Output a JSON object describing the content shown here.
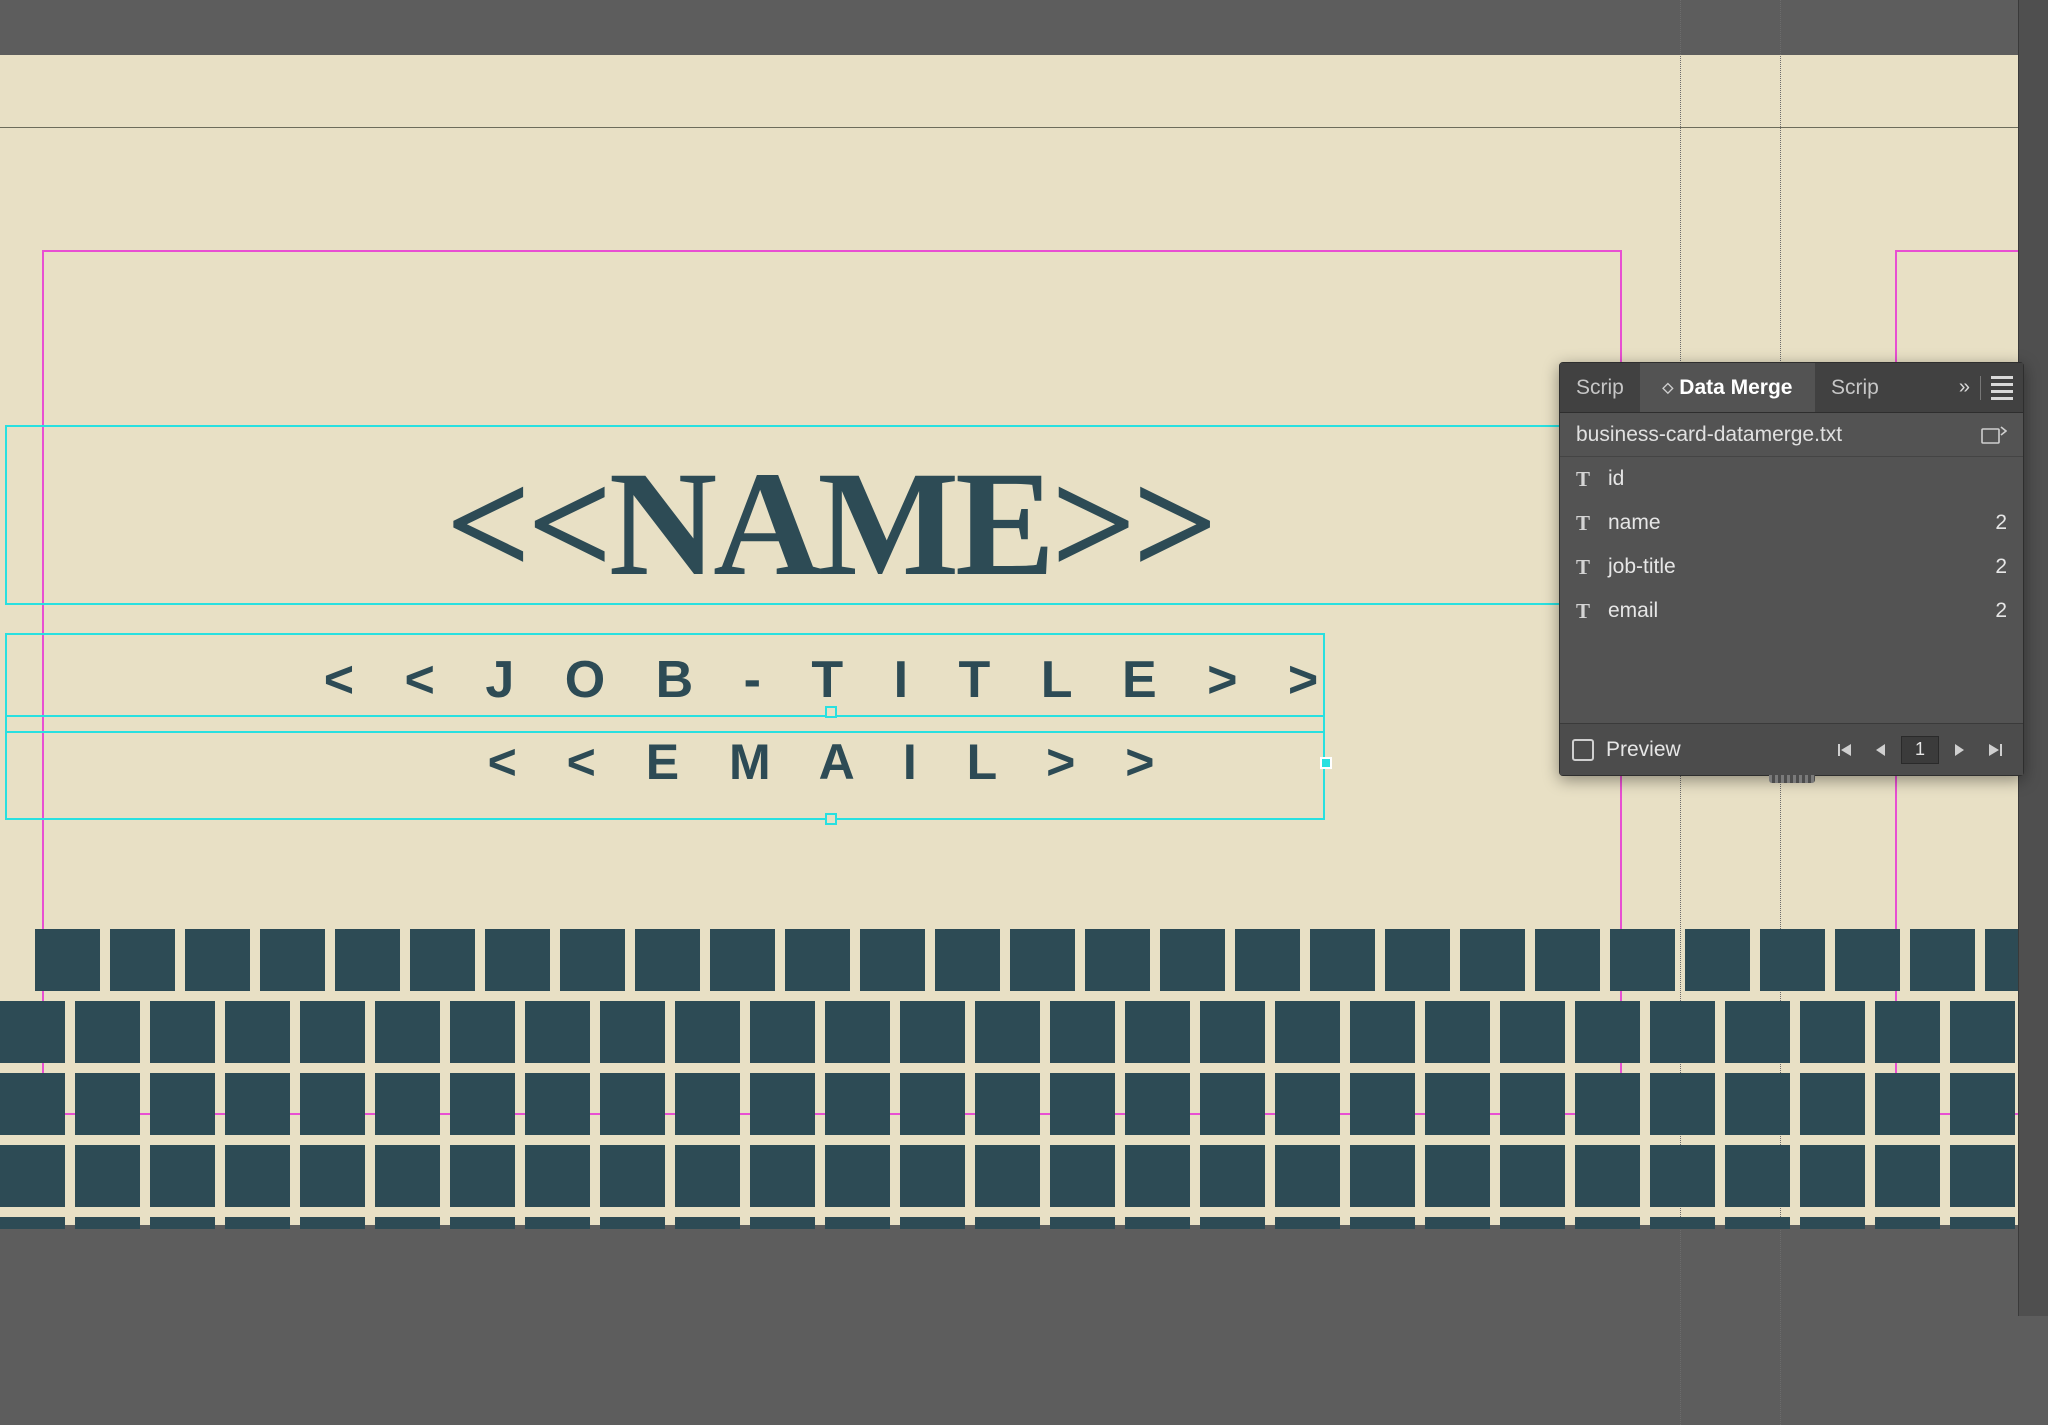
{
  "canvas": {
    "placeholder_name": "<<NAME>>",
    "placeholder_job": "< < J O B - T I T L E > >",
    "placeholder_email": "< < E M A I L > >",
    "grid_rows": 5,
    "grid_cols": 30
  },
  "panel": {
    "tabs": {
      "left": "Scrip",
      "active": "Data Merge",
      "right": "Scrip"
    },
    "data_source": "business-card-datamerge.txt",
    "fields": [
      {
        "name": "id",
        "count": ""
      },
      {
        "name": "name",
        "count": "2"
      },
      {
        "name": "job-title",
        "count": "2"
      },
      {
        "name": "email",
        "count": "2"
      }
    ],
    "footer": {
      "preview_label": "Preview",
      "page": "1"
    }
  }
}
